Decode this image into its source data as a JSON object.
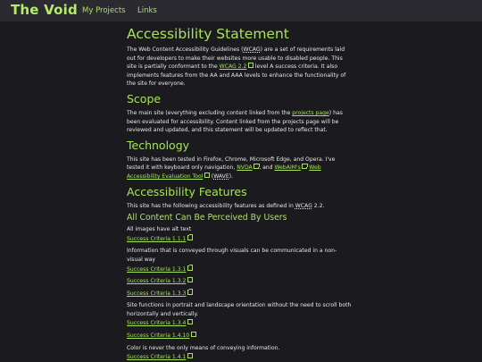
{
  "nav": {
    "brand": "The Void",
    "links": [
      "My Projects",
      "Links"
    ]
  },
  "colors": {
    "accent": "#a6e35b",
    "background": "#1b1b1f",
    "navbar": "#2a2a30",
    "text": "#e8e8ec"
  },
  "icons": {
    "external_link": "external-link-icon"
  },
  "page": {
    "title": "Accessibility Statement",
    "intro": {
      "t1": "The Web Content Accessibility Guidelines (",
      "abbr": "WCAG",
      "t2": ") are a set of requirements laid out for developers to make their websites more usable to disabled people. This site is partially conformant to the ",
      "link": "WCAG 2.2",
      "t3": " level A success criteria. It also implements features from the AA and AAA levels to enhance the functionality of the site for everyone."
    },
    "scope": {
      "heading": "Scope",
      "t1": "The main site (everything excluding content linked from the ",
      "link": "projects page",
      "t2": ") has been evaluated for accessibility. Content linked from the projects page will be reviewed and updated, and this statement will be updated to reflect that."
    },
    "technology": {
      "heading": "Technology",
      "t1": "This site has been tested in Firefox, Chrome, Microsoft Edge, and Opera. I've tested it with keyboard only navigation, ",
      "nvda": "NVDA",
      "t2": ", and ",
      "webaim": "WebAIM's",
      "wave_tool": "Web Accessibility Evaluation Tool",
      "t3": " (",
      "wave": "WAVE",
      "t4": ")."
    },
    "features": {
      "heading": "Accessibility Features",
      "t1": "This site has the following accessibility features as defined in ",
      "abbr": "WCAG",
      "t2": " 2.2.",
      "perceived": {
        "heading": "All Content Can Be Perceived By Users",
        "items": [
          {
            "desc": "All images have alt text",
            "criteria": [
              "Success Criteria 1.1.1"
            ]
          },
          {
            "desc": "Information that is conveyed through visuals can be communicated in a non-visual way",
            "criteria": [
              "Success Criteria 1.3.1",
              "Success Criteria 1.3.2",
              "Success Criteria 1.3.3"
            ]
          },
          {
            "desc": "Site functions in portrait and landscape orientation without the need to scroll both horizontally and vertically.",
            "criteria": [
              "Success Criteria 1.3.4",
              "Success Criteria 1.4.10"
            ]
          },
          {
            "desc": "Color is never the only means of conveying information.",
            "criteria": [
              "Success Criteria 1.4.1"
            ]
          }
        ]
      }
    }
  }
}
